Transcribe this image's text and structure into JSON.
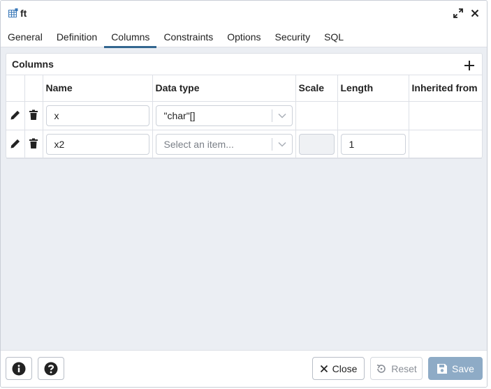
{
  "window": {
    "title": "ft",
    "icon": "table-icon"
  },
  "tabs": [
    {
      "label": "General"
    },
    {
      "label": "Definition"
    },
    {
      "label": "Columns",
      "active": true
    },
    {
      "label": "Constraints"
    },
    {
      "label": "Options"
    },
    {
      "label": "Security"
    },
    {
      "label": "SQL"
    }
  ],
  "columns_panel": {
    "title": "Columns",
    "headers": {
      "name": "Name",
      "data_type": "Data type",
      "scale": "Scale",
      "length": "Length",
      "inherited_from": "Inherited from"
    },
    "rows": [
      {
        "name": "x",
        "data_type": "\"char\"[]",
        "scale": "",
        "length": "",
        "inherited_from": ""
      },
      {
        "name": "x2",
        "data_type_placeholder": "Select an item...",
        "scale": "",
        "length": "1",
        "inherited_from": ""
      }
    ]
  },
  "footer": {
    "close_label": "Close",
    "reset_label": "Reset",
    "save_label": "Save"
  },
  "colors": {
    "accent": "#326690",
    "save_button": "#8eabc6",
    "background": "#ebeef3"
  }
}
